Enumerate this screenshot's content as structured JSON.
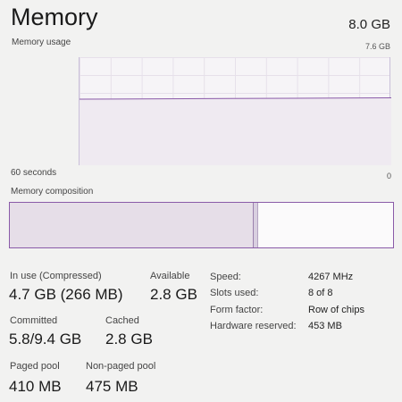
{
  "header": {
    "title": "Memory",
    "total": "8.0 GB",
    "usage_label": "Memory usage",
    "max_label": "7.6 GB"
  },
  "graph": {
    "time_label": "60 seconds",
    "zero_label": "0",
    "usage_fraction": 0.62,
    "line_color": "#8a5aa8"
  },
  "composition": {
    "label": "Memory composition",
    "in_use_fraction": 0.635,
    "modified_fraction": 0.008
  },
  "stats": {
    "in_use_label": "In use (Compressed)",
    "in_use_value": "4.7 GB (266 MB)",
    "available_label": "Available",
    "available_value": "2.8 GB",
    "committed_label": "Committed",
    "committed_value": "5.8/9.4 GB",
    "cached_label": "Cached",
    "cached_value": "2.8 GB",
    "paged_label": "Paged pool",
    "paged_value": "410 MB",
    "nonpaged_label": "Non-paged pool",
    "nonpaged_value": "475 MB"
  },
  "details": [
    {
      "key": "Speed:",
      "value": "4267 MHz"
    },
    {
      "key": "Slots used:",
      "value": "8 of 8"
    },
    {
      "key": "Form factor:",
      "value": "Row of chips"
    },
    {
      "key": "Hardware reserved:",
      "value": "453 MB"
    }
  ]
}
